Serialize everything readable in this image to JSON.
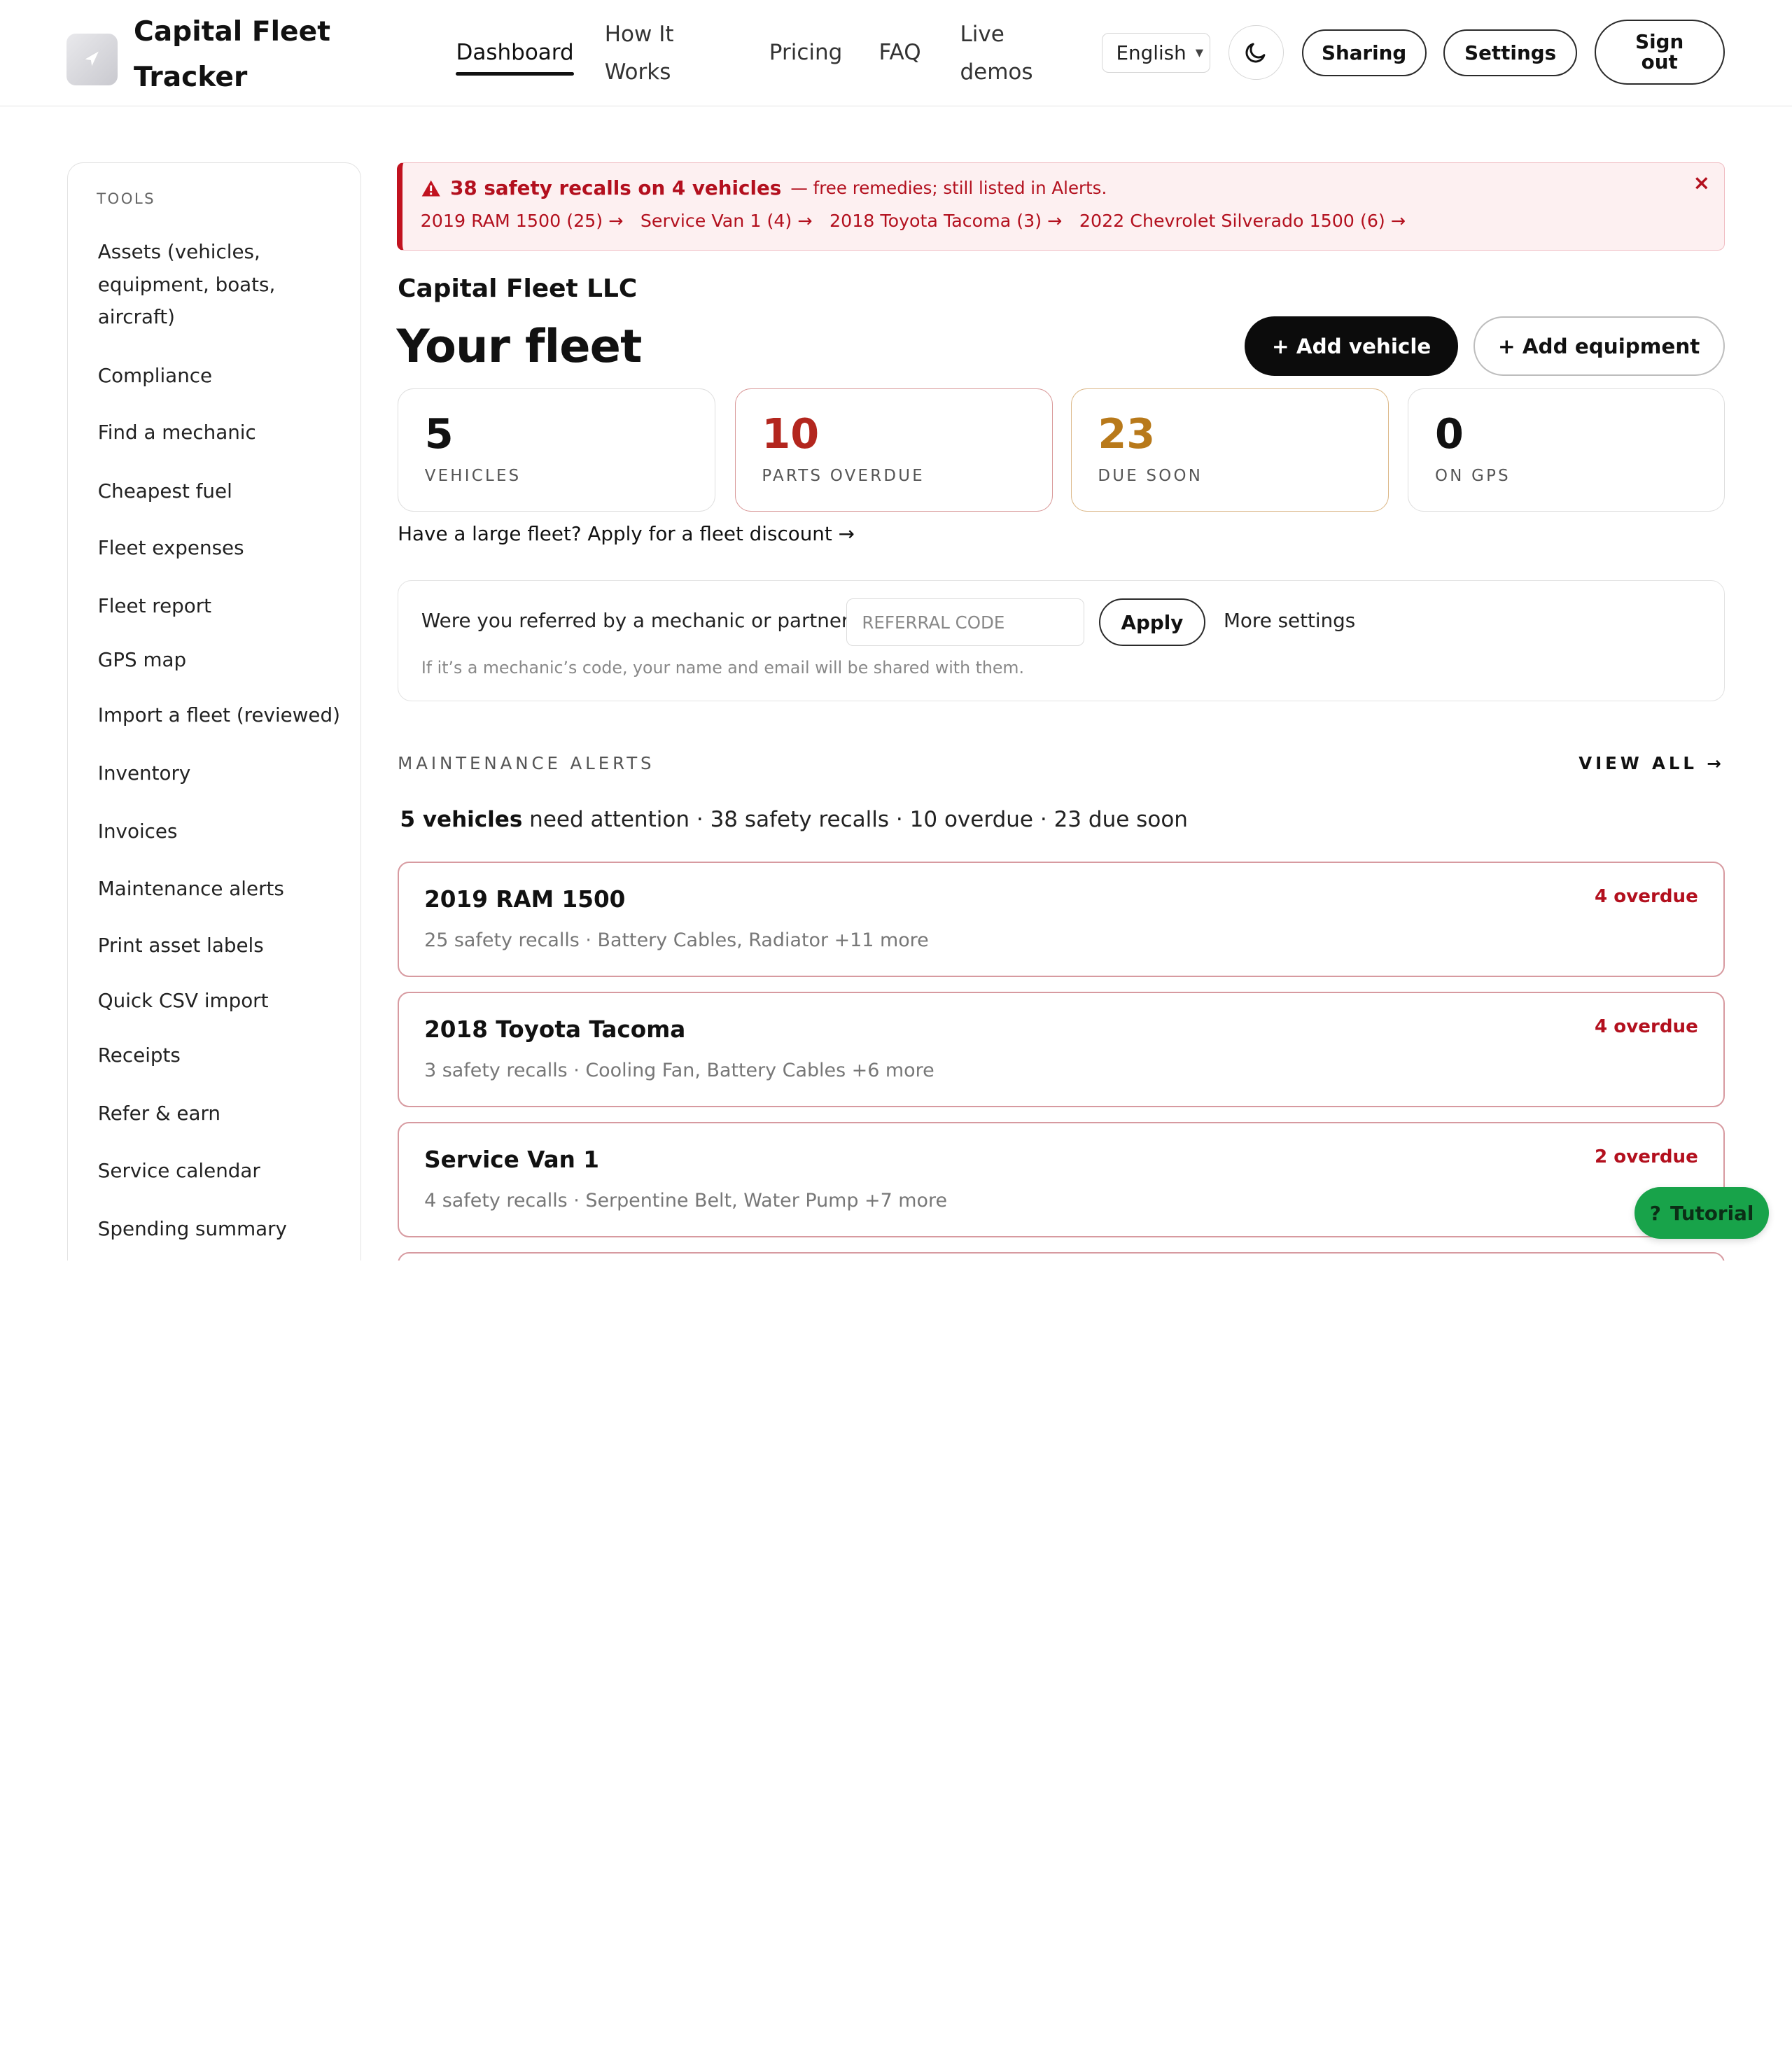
{
  "brand": {
    "name": "Capital Fleet Tracker"
  },
  "nav": {
    "dashboard": "Dashboard",
    "how_it_works": "How It Works",
    "pricing": "Pricing",
    "faq": "FAQ",
    "live_demos": "Live demos",
    "language": "English",
    "sharing": "Sharing",
    "settings": "Settings",
    "sign_out": "Sign out"
  },
  "sidebar": {
    "title": "TOOLS",
    "items": [
      "Assets (vehicles, equipment, boats, aircraft)",
      "Compliance",
      "Find a mechanic",
      "Cheapest fuel",
      "Fleet expenses",
      "Fleet report",
      "GPS map",
      "Import a fleet (reviewed)",
      "Inventory",
      "Invoices",
      "Maintenance alerts",
      "Print asset labels",
      "Quick CSV import",
      "Receipts",
      "Refer & earn",
      "Service calendar",
      "Spending summary"
    ]
  },
  "banner": {
    "title": "38 safety recalls on 4 vehicles",
    "subtitle": "— free remedies; still listed in Alerts.",
    "links": [
      "2019 RAM 1500 (25) →",
      "Service Van 1 (4) →",
      "2018 Toyota Tacoma (3) →",
      "2022 Chevrolet Silverado 1500 (6) →"
    ],
    "close": "×"
  },
  "main": {
    "company": "Capital Fleet LLC",
    "title": "Your fleet",
    "add_vehicle": "+ Add vehicle",
    "add_equipment": "+ Add equipment",
    "discount_link": "Have a large fleet? Apply for a fleet discount →"
  },
  "stats": [
    {
      "value": "5",
      "label": "VEHICLES",
      "color": "#111111",
      "border": "#dedede"
    },
    {
      "value": "10",
      "label": "PARTS OVERDUE",
      "color": "#b3261e",
      "border": "#d99a9a"
    },
    {
      "value": "23",
      "label": "DUE SOON",
      "color": "#b8791a",
      "border": "#dcb98a"
    },
    {
      "value": "0",
      "label": "ON GPS",
      "color": "#111111",
      "border": "#dedede"
    }
  ],
  "referral": {
    "question": "Were you referred by a mechanic or partner?",
    "placeholder": "REFERRAL CODE",
    "apply": "Apply",
    "more": "More settings",
    "note": "If it’s a mechanic’s code, your name and email will be shared with them."
  },
  "alerts": {
    "section_label": "MAINTENANCE ALERTS",
    "view_all": "VIEW ALL →",
    "summary_bold": "5 vehicles",
    "summary_rest": " need attention · 38 safety recalls · 10 overdue · 23 due soon",
    "cards": [
      {
        "name": "2019 RAM 1500",
        "detail": "25 safety recalls · Battery Cables, Radiator +11 more",
        "status": "4 overdue"
      },
      {
        "name": "2018 Toyota Tacoma",
        "detail": "3 safety recalls · Cooling Fan, Battery Cables +6 more",
        "status": "4 overdue"
      },
      {
        "name": "Service Van 1",
        "detail": "4 safety recalls · Serpentine Belt, Water Pump +7 more",
        "status": "2 overdue"
      }
    ]
  },
  "tutorial": {
    "icon": "?",
    "label": "Tutorial"
  },
  "colors": {
    "accent": "#0c0c0c",
    "danger": "#b3101e",
    "warning": "#b8791a",
    "success": "#18a34a"
  }
}
